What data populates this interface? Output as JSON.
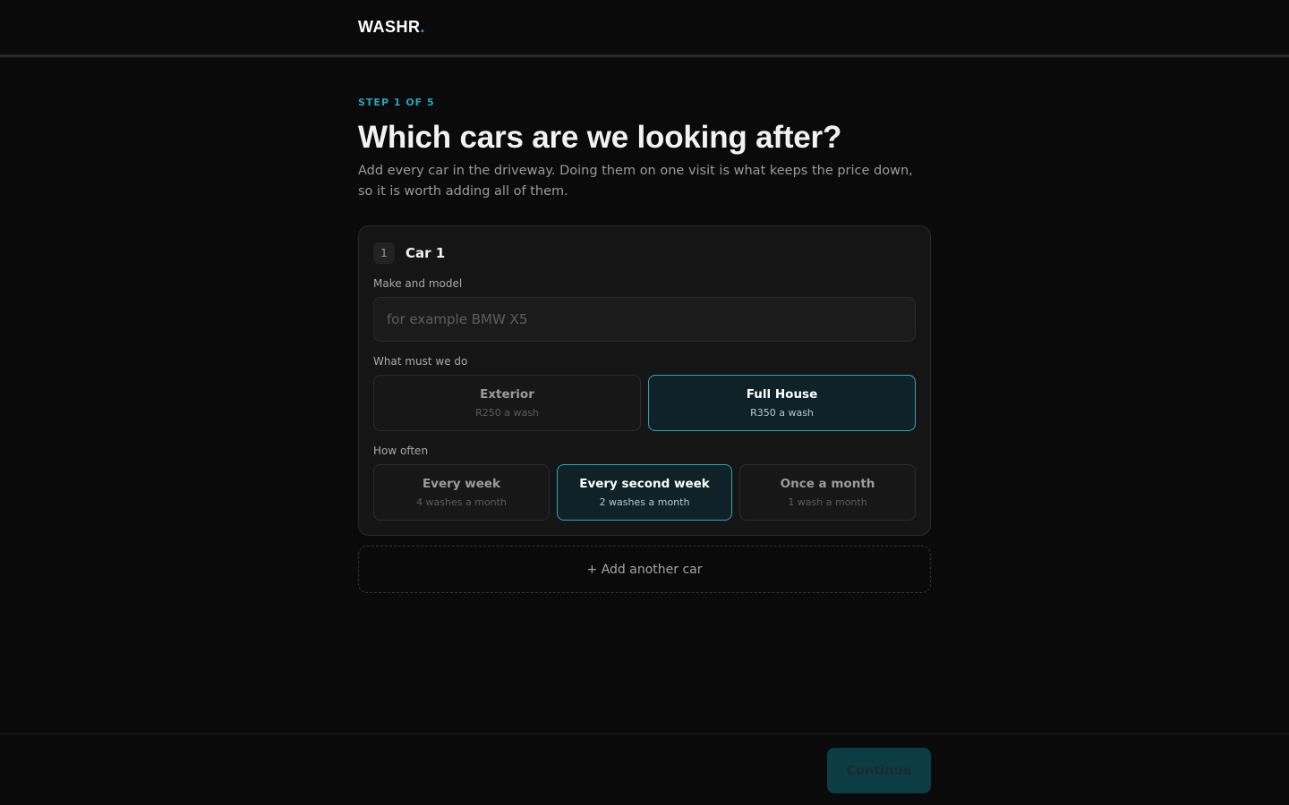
{
  "header": {
    "brand": "WASHR",
    "brand_dot": ".",
    "accent": "#22a7bd"
  },
  "step": {
    "label": "STEP 1 OF 5"
  },
  "heading": {
    "title": "Which cars are we looking after?",
    "subtitle": "Add every car in the driveway. Doing them on one visit is what keeps the price down, so it is worth adding all of them."
  },
  "car": {
    "number": "1",
    "title": "Car 1",
    "make_label": "Make and model",
    "make_value": "",
    "make_placeholder": "for example BMW X5",
    "service_label": "What must we do",
    "services": [
      {
        "title": "Exterior",
        "price": "R250 a wash",
        "selected": false
      },
      {
        "title": "Full House",
        "price": "R350 a wash",
        "selected": true
      }
    ],
    "frequency_label": "How often",
    "frequencies": [
      {
        "title": "Every week",
        "detail": "4 washes a month",
        "selected": false
      },
      {
        "title": "Every second week",
        "detail": "2 washes a month",
        "selected": true
      },
      {
        "title": "Once a month",
        "detail": "1 wash a month",
        "selected": false
      }
    ]
  },
  "add_car": {
    "label": "+ Add another car"
  },
  "footer": {
    "continue_label": "Continue"
  }
}
